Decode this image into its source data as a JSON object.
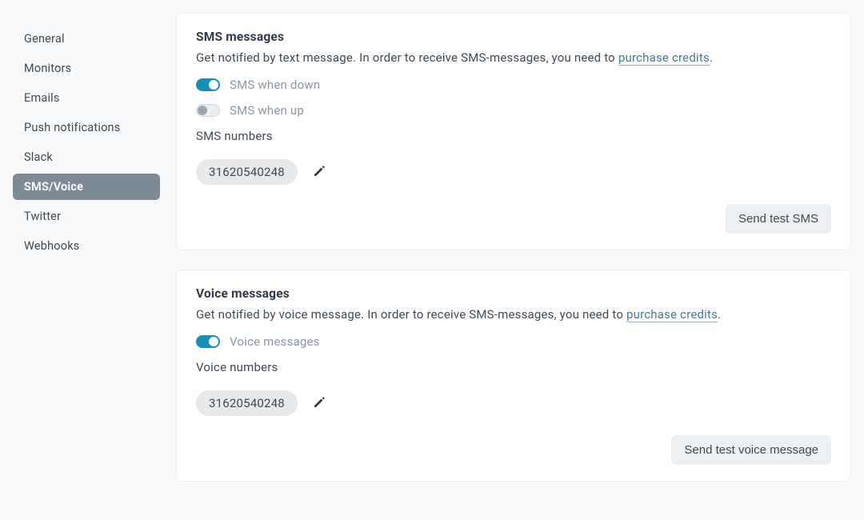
{
  "sidebar": {
    "items": [
      {
        "label": "General",
        "active": false
      },
      {
        "label": "Monitors",
        "active": false
      },
      {
        "label": "Emails",
        "active": false
      },
      {
        "label": "Push notifications",
        "active": false
      },
      {
        "label": "Slack",
        "active": false
      },
      {
        "label": "SMS/Voice",
        "active": true
      },
      {
        "label": "Twitter",
        "active": false
      },
      {
        "label": "Webhooks",
        "active": false
      }
    ]
  },
  "sms_card": {
    "title": "SMS messages",
    "desc_prefix": "Get notified by text message. In order to receive SMS-messages, you need to ",
    "link_text": "purchase credits",
    "desc_suffix": ".",
    "toggle_down": {
      "label": "SMS when down",
      "on": true
    },
    "toggle_up": {
      "label": "SMS when up",
      "on": false
    },
    "numbers_label": "SMS numbers",
    "number": "31620540248",
    "test_button": "Send test SMS"
  },
  "voice_card": {
    "title": "Voice messages",
    "desc_prefix": "Get notified by voice message. In order to receive SMS-messages, you need to ",
    "link_text": "purchase credits",
    "desc_suffix": ".",
    "toggle": {
      "label": "Voice messages",
      "on": true
    },
    "numbers_label": "Voice numbers",
    "number": "31620540248",
    "test_button": "Send test voice message"
  }
}
